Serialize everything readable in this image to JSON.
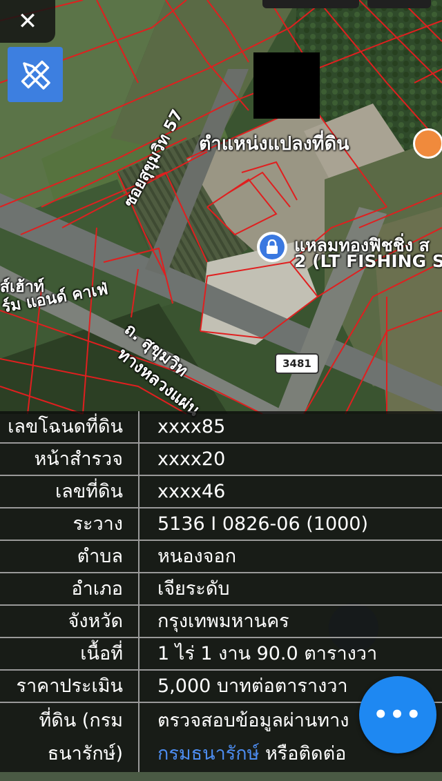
{
  "map": {
    "parcel_label": "ตำแหน่งแปลงที่ดิน",
    "poi_name_line1": "แหลมทองฟิชชิ่ง ส",
    "poi_name_line2": "2 (LT FISHING S",
    "street_soi": "ซอยสุขุมวิท 57",
    "street_main_line1": "ถ. สุขุมวิท",
    "street_main_line2": "ทางหลวงแผ่น",
    "cafe_line1": "ส์เฮ้าท์",
    "cafe_line2": "ร์ม แอนด์ คาเฟ่",
    "road_number": "3481"
  },
  "controls": {
    "close_symbol": "✕",
    "more_symbol": "•••"
  },
  "info_table": [
    {
      "label": "เลขโฉนดที่ดิน",
      "value": "xxxx85"
    },
    {
      "label": "หน้าสำรวจ",
      "value": "xxxx20"
    },
    {
      "label": "เลขที่ดิน",
      "value": "xxxx46"
    },
    {
      "label": "ระวาง",
      "value": "5136 I 0826-06 (1000)"
    },
    {
      "label": "ตำบล",
      "value": "หนองจอก"
    },
    {
      "label": "อำเภอ",
      "value": "เจียระดับ"
    },
    {
      "label": "จังหวัด",
      "value": "กรุงเทพมหานคร"
    },
    {
      "label": "เนื้อที่",
      "value": "1 ไร่ 1 งาน 90.0 ตารางวา"
    },
    {
      "label": "ราคาประเมิน",
      "value": "5,000 บาทต่อตารางวา"
    },
    {
      "label_line1": "ที่ดิน (กรม",
      "label_line2": "ธนารักษ์)",
      "value_line1": "ตรวจสอบข้อมูลผ่านทาง",
      "value_link": "กรมธนารักษ์",
      "value_line2_rest": " หรือติดต่อ"
    }
  ]
}
